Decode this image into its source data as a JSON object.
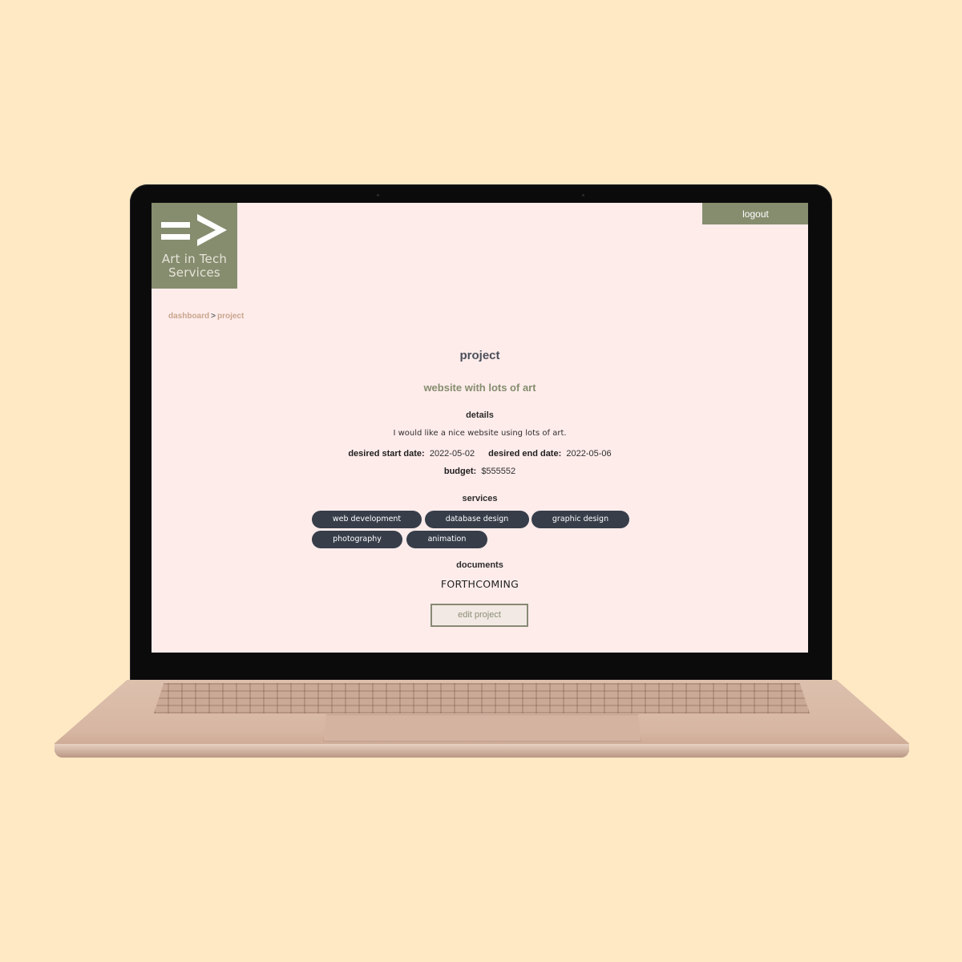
{
  "brand": {
    "logo_line1": "Art in Tech",
    "logo_line2": "Services",
    "color": "#858d6e"
  },
  "header": {
    "logout_label": "logout"
  },
  "breadcrumb": {
    "items": [
      "dashboard",
      "project"
    ],
    "separator": ">"
  },
  "page": {
    "title": "project",
    "project_name": "website with lots of art",
    "details_heading": "details",
    "description": "I would like a nice website using lots of art.",
    "start_label": "desired start date:",
    "start_value": "2022-05-02",
    "end_label": "desired end date:",
    "end_value": "2022-05-06",
    "budget_label": "budget:",
    "budget_value": "$555552",
    "services_heading": "services",
    "services": [
      "web development",
      "database design",
      "graphic design",
      "photography",
      "animation"
    ],
    "documents_heading": "documents",
    "documents_value": "FORTHCOMING",
    "edit_button": "edit project"
  },
  "colors": {
    "background": "#ffe9c4",
    "screen": "#feeceb",
    "chip": "#373e4a",
    "accent": "#858d6e"
  },
  "icons": [
    "logo-arrow-icon"
  ]
}
